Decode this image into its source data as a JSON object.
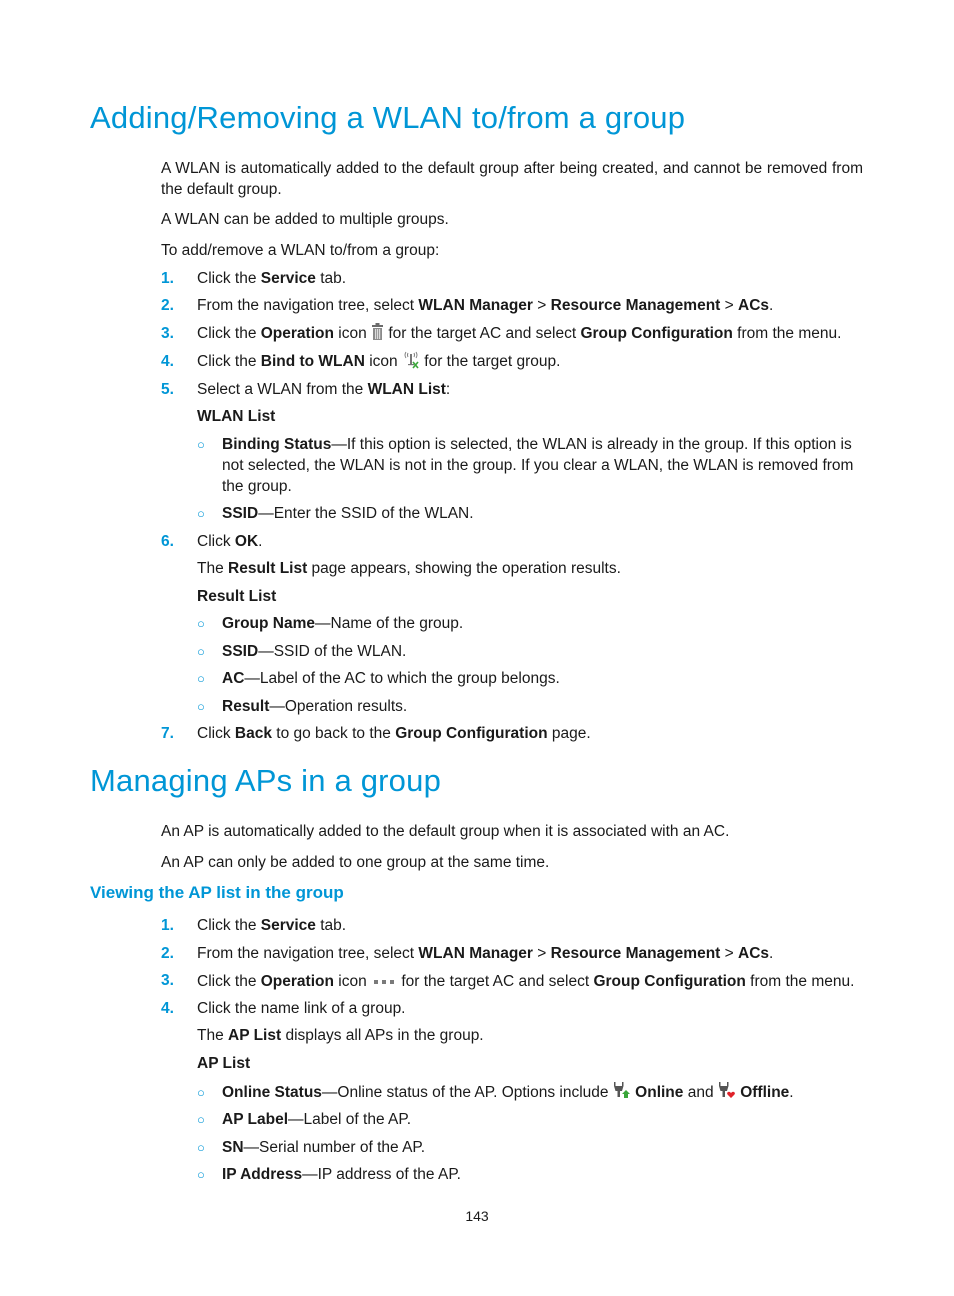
{
  "section1": {
    "title": "Adding/Removing a WLAN to/from a group",
    "intro": [
      "A WLAN is automatically added to the default group after being created, and cannot be removed from the default group.",
      "A WLAN can be added to multiple groups.",
      "To add/remove a WLAN to/from a group:"
    ],
    "steps": [
      {
        "num": "1.",
        "pre": "Click the ",
        "b1": "Service",
        "post": " tab."
      },
      {
        "num": "2.",
        "pre": "From the navigation tree, select ",
        "b1": "WLAN Manager",
        "s1": " > ",
        "b2": "Resource Management",
        "s2": " > ",
        "b3": "ACs",
        "post": "."
      },
      {
        "num": "3.",
        "pre": "Click the ",
        "b1": "Operation",
        "mid": " icon ",
        "icon": "trash-icon",
        "mid2": " for the target AC and select ",
        "b2": "Group Configuration",
        "post": " from the menu."
      },
      {
        "num": "4.",
        "pre": "Click the ",
        "b1": "Bind to WLAN",
        "mid": " icon ",
        "icon": "bind-wlan-icon",
        "post": " for the target group."
      },
      {
        "num": "5.",
        "pre": "Select a WLAN from the ",
        "b1": "WLAN List",
        "post": ":"
      },
      {
        "num": "6.",
        "pre": "Click ",
        "b1": "OK",
        "post": "."
      },
      {
        "num": "7.",
        "pre": "Click ",
        "b1": "Back",
        "mid": " to go back to the ",
        "b2": "Group Configuration",
        "post": " page."
      }
    ],
    "wlan_list": {
      "heading": "WLAN List",
      "items": [
        {
          "term": "Binding Status",
          "desc": "—If this option is selected, the WLAN is already in the group. If this option is not selected, the WLAN is not in the group. If you clear a WLAN, the WLAN is removed from the group."
        },
        {
          "term": "SSID",
          "desc": "—Enter the SSID of the WLAN."
        }
      ]
    },
    "result_note": {
      "pre": "The ",
      "b": "Result List",
      "post": " page appears, showing the operation results."
    },
    "result_list": {
      "heading": "Result List",
      "items": [
        {
          "term": "Group Name",
          "desc": "—Name of the group."
        },
        {
          "term": "SSID",
          "desc": "—SSID of the WLAN."
        },
        {
          "term": "AC",
          "desc": "—Label of the AC to which the group belongs."
        },
        {
          "term": "Result",
          "desc": "—Operation results."
        }
      ]
    }
  },
  "section2": {
    "title": "Managing APs in a group",
    "intro": [
      "An AP is automatically added to the default group when it is associated with an AC.",
      "An AP can only be added to one group at the same time."
    ],
    "subsection": {
      "title": "Viewing the AP list in the group",
      "steps": [
        {
          "num": "1.",
          "pre": "Click the ",
          "b1": "Service",
          "post": " tab."
        },
        {
          "num": "2.",
          "pre": "From the navigation tree, select ",
          "b1": "WLAN Manager",
          "s1": " > ",
          "b2": "Resource Management",
          "s2": " > ",
          "b3": "ACs",
          "post": "."
        },
        {
          "num": "3.",
          "pre": "Click the ",
          "b1": "Operation",
          "mid": " icon ",
          "icon": "more-dots-icon",
          "mid2": " for the target AC and select ",
          "b2": "Group Configuration",
          "post": " from the menu."
        },
        {
          "num": "4.",
          "pre": "Click the name link of a group."
        }
      ],
      "ap_note": {
        "pre": "The ",
        "b": "AP List",
        "post": " displays all APs in the group."
      },
      "ap_list": {
        "heading": "AP List",
        "items": [
          {
            "term": "Online Status",
            "desc": "—Online status of the AP. Options include ",
            "online": "Online",
            "and": " and ",
            "offline": "Offline",
            "end": "."
          },
          {
            "term": "AP Label",
            "desc": "—Label of the AP."
          },
          {
            "term": "SN",
            "desc": "—Serial number of the AP."
          },
          {
            "term": "IP Address",
            "desc": "—IP address of the AP."
          }
        ]
      }
    }
  },
  "footer": {
    "page_number": "143"
  },
  "colors": {
    "accent": "#0096d6",
    "text": "#1a1a1a",
    "online": "#3aa63a",
    "offline": "#e0222a"
  }
}
